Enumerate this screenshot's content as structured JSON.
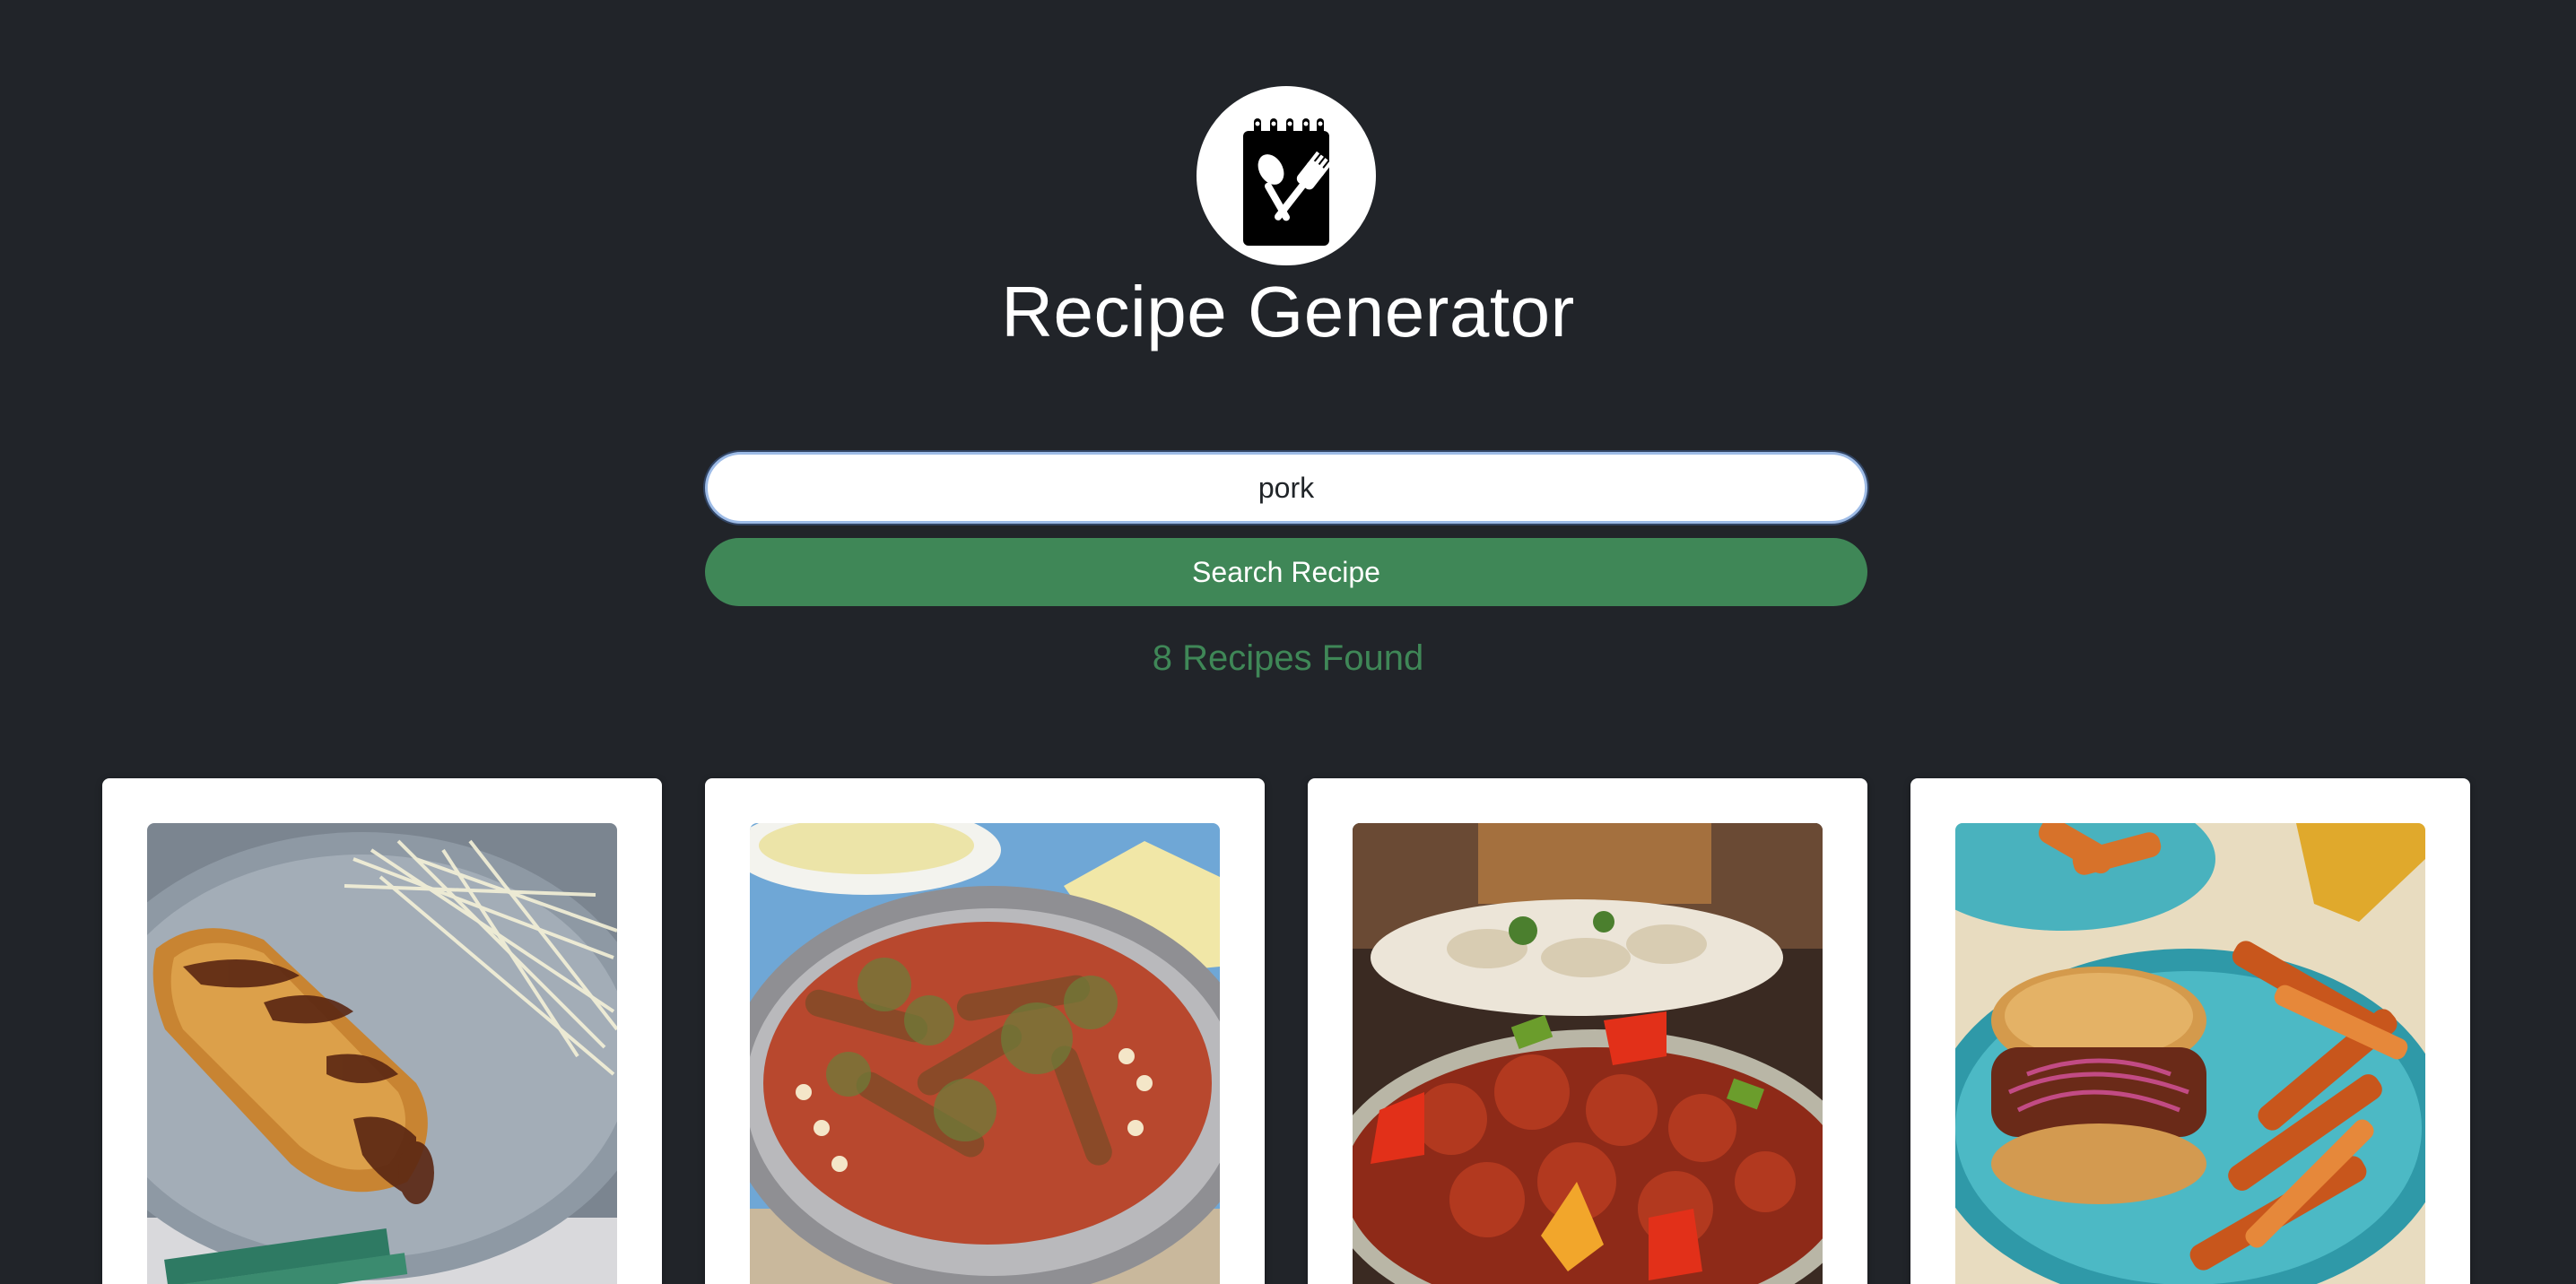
{
  "header": {
    "logo_icon": "recipe-notepad-utensils-icon",
    "title": "Recipe Generator"
  },
  "search": {
    "value": "pork",
    "button_label": "Search Recipe"
  },
  "results": {
    "count_text": "8 Recipes Found"
  },
  "colors": {
    "background": "#212429",
    "accent_green": "#3f8757",
    "card": "#ffffff"
  },
  "recipe_cards": [
    {
      "image": "pork-cutlet-food-photo"
    },
    {
      "image": "sausage-bean-casserole-food-photo"
    },
    {
      "image": "sweet-and-sour-pork-food-photo"
    },
    {
      "image": "pulled-pork-sandwich-fries-food-photo"
    }
  ]
}
